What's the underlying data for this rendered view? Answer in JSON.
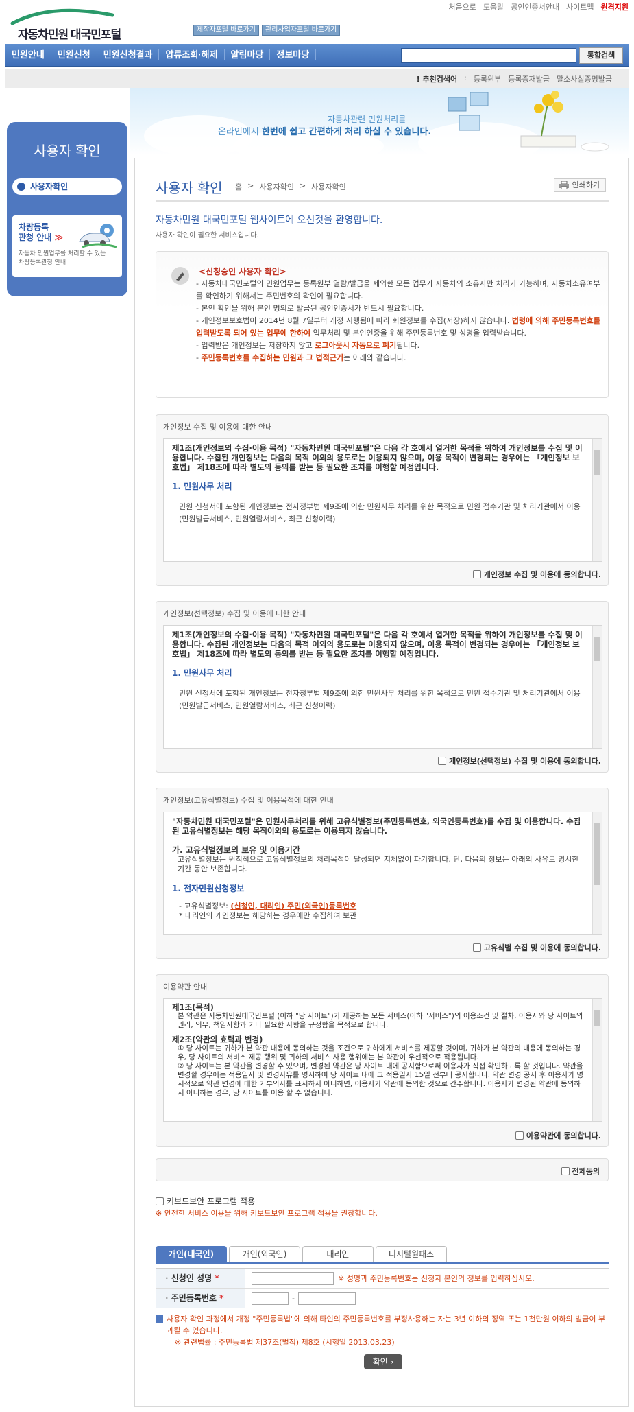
{
  "util_links": [
    "처음으로",
    "도움말",
    "공인인증서안내",
    "사이트맵",
    "원격지원"
  ],
  "logo": {
    "text": "자동차민원 대국민포털"
  },
  "top_buttons": [
    "제작자포털 바로가기",
    "관리사업자포털 바로가기"
  ],
  "gnb": [
    "민원안내",
    "민원신청",
    "민원신청결과",
    "압류조회·해제",
    "알림마당",
    "정보마당"
  ],
  "search": {
    "placeholder": "",
    "button": "통합검색"
  },
  "recommend": {
    "label": "추천검색어",
    "items": [
      "등록원부",
      "등록증재발급",
      "말소사실증명발급"
    ]
  },
  "banner": {
    "line1": "자동차관련 민원처리를",
    "line2a": "온라인에서 ",
    "line2b": "한번에 쉽고 간편하게 처리 하실 수 있습니다."
  },
  "sidebar": {
    "title": "사용자 확인",
    "menu": "사용자확인",
    "promo": {
      "title1": "차량등록",
      "title2": "관청 안내",
      "arrow": "≫",
      "desc": "자동차 민원업무를 처리할 수 있는 차량등록관청 안내"
    }
  },
  "page": {
    "title": "사용자 확인",
    "breadcrumb": [
      "홈",
      ">",
      "사용자확인",
      ">",
      "사용자확인"
    ],
    "print": "인쇄하기",
    "welcome": "자동차민원 대국민포털 웹사이트에 오신것을 환영합니다.",
    "welcome_sub": "사용자 확인이 필요한 서비스입니다."
  },
  "notice": {
    "title": "<신청승인 사용자 확인>",
    "items": [
      {
        "text": "- 자동차대국민포털의 민원업무는 등록원부 열람/발급을 제외한 모든 업무가 자동차의 소유자만 처리가 가능하며, 자동차소유여부를 확인하기 위해서는 주민번호의 확인이 필요합니다."
      },
      {
        "text": "- 본인 확인을 위해 본인 명의로 발급된 공인인증서가 반드시 필요합니다."
      },
      {
        "pre": "- 개인정보보호법이 2014년 8월 7일부터 개정 시행됨에 따라 회원정보를 수집(저장)하지 않습니다. ",
        "em": "법령에 의해 주민등록번호를 입력받도록 되어 있는 업무에 한하여",
        "post": " 업무처리 및 본인인증을 위해 주민등록번호 및 성명을 입력받습니다."
      },
      {
        "pre": "- 입력받은 개인정보는 저장하지 않고 ",
        "em": "로그아웃시 자동으로 폐기",
        "post": "됩니다."
      },
      {
        "pre": "- ",
        "em": "주민등록번호를 수집하는 민원과 그 법적근거",
        "post": "는 아래와 같습니다."
      }
    ]
  },
  "consents": [
    {
      "head": "개인정보 수집 및 이용에 대한 안내",
      "article": "제1조(개인정보의 수집·이용 목적) \"자동차민원 대국민포털\"은 다음 각 호에서 열거한 목적을 위하여 개인정보를 수집 및 이용합니다. 수집된 개인정보는 다음의 목적 이외의 용도로는 이용되지 않으며, 이용 목적이 변경되는 경우에는 「개인정보 보호법」 제18조에 따라 별도의 동의를 받는 등 필요한 조치를 이행할 예정입니다.",
      "section": "1. 민원사무 처리",
      "body": "민원 신청서에 포함된 개인정보는 전자정부법 제9조에 의한 민원사무 처리를 위한 목적으로 민원 접수기관 및 처리기관에서 이용 (민원발급서비스, 민원열람서비스, 최근 신청이력)",
      "agree": "개인정보 수집 및 이용에 동의합니다."
    },
    {
      "head": "개인정보(선택정보) 수집 및 이용에 대한 안내",
      "article": "제1조(개인정보의 수집·이용 목적) \"자동차민원 대국민포털\"은 다음 각 호에서 열거한 목적을 위하여 개인정보를 수집 및 이용합니다. 수집된 개인정보는 다음의 목적 이외의 용도로는 이용되지 않으며, 이용 목적이 변경되는 경우에는 「개인정보 보호법」 제18조에 따라 별도의 동의를 받는 등 필요한 조치를 이행할 예정입니다.",
      "section": "1. 민원사무 처리",
      "body": "민원 신청서에 포함된 개인정보는 전자정부법 제9조에 의한 민원사무 처리를 위한 목적으로 민원 접수기관 및 처리기관에서 이용 (민원발급서비스, 민원열람서비스, 최근 신청이력)",
      "agree": "개인정보(선택정보) 수집 및 이용에 동의합니다."
    },
    {
      "head": "개인정보(고유식별정보) 수집 및 이용목적에 대한 안내",
      "article": "\"자동차민원 대국민포털\"은 민원사무처리를 위해 고유식별정보(주민등록번호, 외국인등록번호)를 수집 및 이용합니다. 수집된 고유식별정보는 해당 목적이외의 용도로는 이용되지 않습니다.",
      "subhead": "가. 고유식별정보의 보유 및 이용기간",
      "subbody": "고유식별정보는 원칙적으로 고유식별정보의 처리목적이 달성되면 지체없이 파기합니다. 단, 다음의 정보는 아래의 사유로 명시한 기간 동안 보존합니다.",
      "section": "1. 전자민원신청정보",
      "item_pre": "- 고유식별정보: ",
      "item_em": "(신청인, 대리인) 주민(외국인)등록번호",
      "item_next": "* 대리인의 개인정보는 해당하는 경우에만 수집하여 보관",
      "agree": "고유식별 수집 및 이용에 동의합니다."
    },
    {
      "head": "이용약관 안내",
      "a1_title": "제1조(목적)",
      "a1_body": "본 약관은 자동차민원대국민포털 (이하 \"당 사이트\")가 제공하는 모든 서비스(이하 \"서비스\")의 이용조건 및 절차, 이용자와 당 사이트의 권리, 의무, 책임사항과 기타 필요한 사항을 규정함을 목적으로 합니다.",
      "a2_title": "제2조(약관의 효력과 변경)",
      "a2_body1": "① 당 사이트는 귀하가 본 약관 내용에 동의하는 것을 조건으로 귀하에게 서비스를 제공할 것이며, 귀하가 본 약관의 내용에 동의하는 경우, 당 사이트의 서비스 제공 행위 및 귀하의 서비스 사용 행위에는 본 약관이 우선적으로 적용됩니다.",
      "a2_body2": "② 당 사이트는 본 약관을 변경할 수 있으며, 변경된 약관은 당 사이트 내에 공지함으로써 이용자가 직접 확인하도록 할 것입니다. 약관을 변경할 경우에는 적용일자 및 변경사유를 명시하여 당 사이트 내에 그 적용일자 15일 전부터 공지합니다. 약관 변경 공지 후 이용자가 명시적으로 약관 변경에 대한 거부의사를 표시하지 아니하면, 이용자가 약관에 동의한 것으로 간주합니다. 이용자가 변경된 약관에 동의하지 아니하는 경우, 당 사이트를 이용 할 수 없습니다.",
      "agree": "이용약관에 동의합니다."
    }
  ],
  "all_agree": "전체동의",
  "keyboard": {
    "label": "키보드보안 프로그램 적용",
    "note": "※ 안전한 서비스 이용을 위해 키보드보안 프로그램 적용을 권장합니다."
  },
  "tabs": [
    "개인(내국인)",
    "개인(외국인)",
    "대리인",
    "디지털원패스"
  ],
  "form": {
    "name_label": "신청인 성명",
    "required": "*",
    "name_hint": "※ 성명과 주민등록번호는 신청자 본인의 정보를 입력하십시오.",
    "rrn_label": "주민등록번호",
    "rrn_dash": "-"
  },
  "law": {
    "main": "사용자 확인 과정에서 개정 \"주민등록법\"에 의해 타인의 주민등록번호를 부정사용하는 자는 3년 이하의 징역 또는 1천만원 이하의 벌금이 부과될 수 있습니다.",
    "note": "※ 관련법률 : 주민등록법 제37조(벌칙) 제8호 (시행일 2013.03.23)"
  },
  "confirm": "확인 ›"
}
